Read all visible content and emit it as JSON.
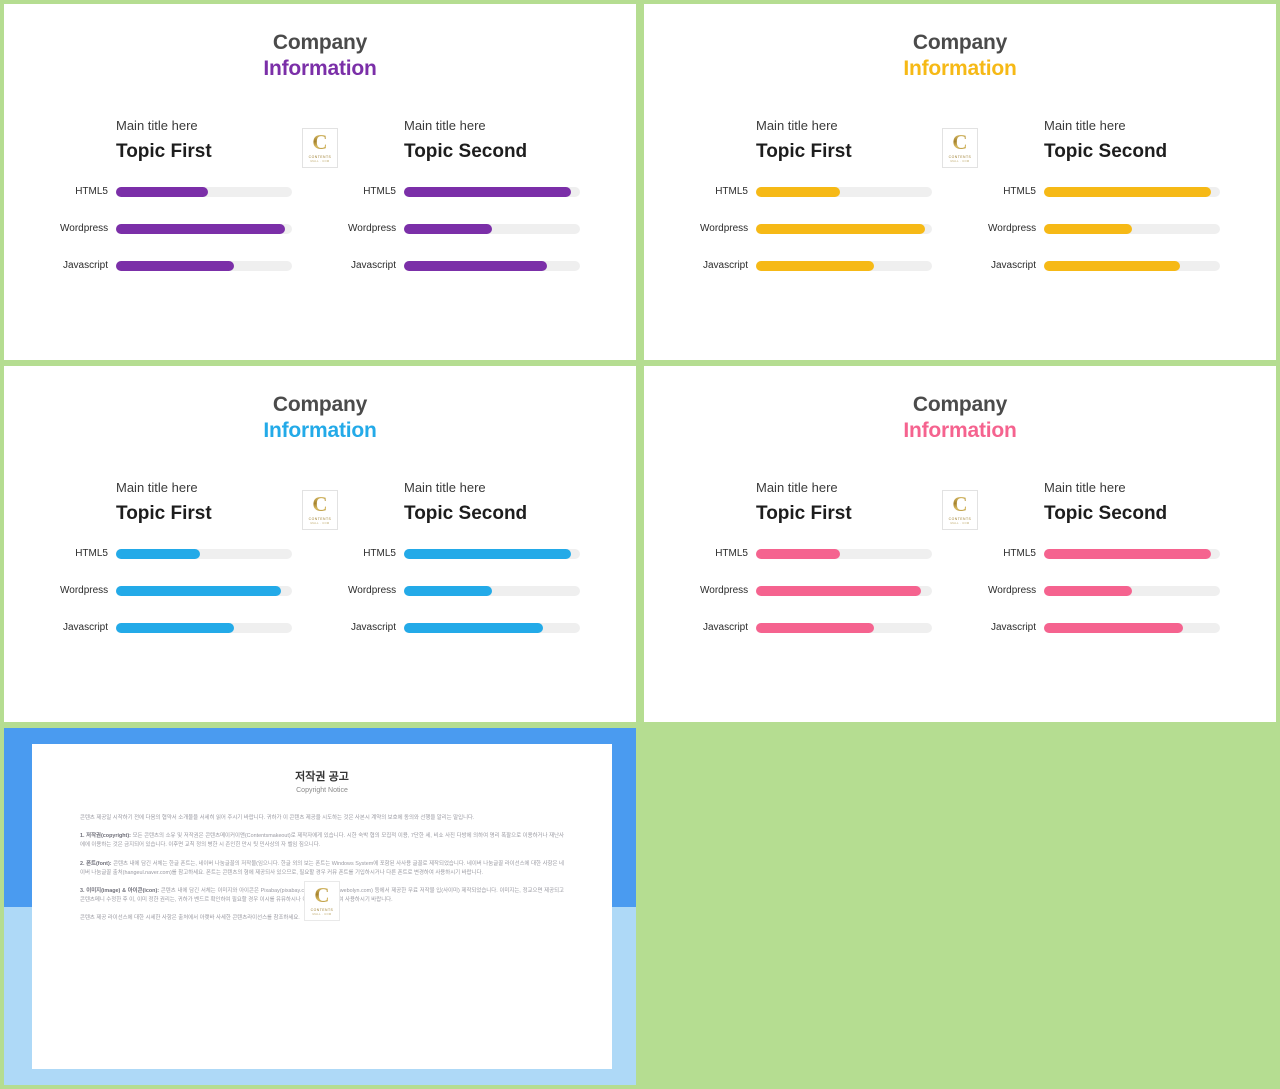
{
  "theme": {
    "background_green": "#b5dd91",
    "heading_dark": "#4b4b4b",
    "track_gray": "#efefef"
  },
  "slides": [
    {
      "id": "slide-purple",
      "accent": "#7b2fa8",
      "header": {
        "line1": "Company",
        "line2": "Information"
      },
      "left": {
        "subtitle": "Main title here",
        "title": "Topic First",
        "bars": [
          {
            "label": "HTML5",
            "value": 52
          },
          {
            "label": "Wordpress",
            "value": 96
          },
          {
            "label": "Javascript",
            "value": 67
          }
        ]
      },
      "right": {
        "subtitle": "Main title here",
        "title": "Topic Second",
        "bars": [
          {
            "label": "HTML5",
            "value": 95
          },
          {
            "label": "Wordpress",
            "value": 50
          },
          {
            "label": "Javascript",
            "value": 81
          }
        ]
      }
    },
    {
      "id": "slide-amber",
      "accent": "#f6b916",
      "header": {
        "line1": "Company",
        "line2": "Information"
      },
      "left": {
        "subtitle": "Main title here",
        "title": "Topic First",
        "bars": [
          {
            "label": "HTML5",
            "value": 48
          },
          {
            "label": "Wordpress",
            "value": 96
          },
          {
            "label": "Javascript",
            "value": 67
          }
        ]
      },
      "right": {
        "subtitle": "Main title here",
        "title": "Topic Second",
        "bars": [
          {
            "label": "HTML5",
            "value": 95
          },
          {
            "label": "Wordpress",
            "value": 50
          },
          {
            "label": "Javascript",
            "value": 77
          }
        ]
      }
    },
    {
      "id": "slide-cyan",
      "accent": "#23aae8",
      "header": {
        "line1": "Company",
        "line2": "Information"
      },
      "left": {
        "subtitle": "Main title here",
        "title": "Topic First",
        "bars": [
          {
            "label": "HTML5",
            "value": 48
          },
          {
            "label": "Wordpress",
            "value": 94
          },
          {
            "label": "Javascript",
            "value": 67
          }
        ]
      },
      "right": {
        "subtitle": "Main title here",
        "title": "Topic Second",
        "bars": [
          {
            "label": "HTML5",
            "value": 95
          },
          {
            "label": "Wordpress",
            "value": 50
          },
          {
            "label": "Javascript",
            "value": 79
          }
        ]
      }
    },
    {
      "id": "slide-pink",
      "accent": "#f5638f",
      "header": {
        "line1": "Company",
        "line2": "Information"
      },
      "left": {
        "subtitle": "Main title here",
        "title": "Topic First",
        "bars": [
          {
            "label": "HTML5",
            "value": 48
          },
          {
            "label": "Wordpress",
            "value": 94
          },
          {
            "label": "Javascript",
            "value": 67
          }
        ]
      },
      "right": {
        "subtitle": "Main title here",
        "title": "Topic Second",
        "bars": [
          {
            "label": "HTML5",
            "value": 95
          },
          {
            "label": "Wordpress",
            "value": 50
          },
          {
            "label": "Javascript",
            "value": 79
          }
        ]
      }
    }
  ],
  "logo": {
    "letter": "C",
    "wordmark": "CONTENTS",
    "tagline": "MALL . COM",
    "gold": "#a5822c"
  },
  "copyright_panel": {
    "frame_top_color": "#4a9bf0",
    "frame_bottom_color": "#aed9f7",
    "title": "저작권 공고",
    "subtitle": "Copyright Notice",
    "paragraphs": [
      {
        "heading": "",
        "text": "콘텐츠 제공일 시작하기 전에 다음의 협약서 소개물을 서세히 읽어 주시기 바랍니다. 귀하가 이 콘텐츠 제공을 시도하는 것은 사본시 계약의 보호에 동의와 선행을 알리는 말입니다."
      },
      {
        "heading": "1. 저작권(copyright):",
        "text": " 모든 콘텐츠의 소유 및 저작권은 콘텐츠메이커이앤(Contentsmakeout)로 제작자에게 있습니다. 시한 숙박 협의 모집적 이용, 7단한 세, 비쇼 사진 다방에 의하여 명리 폭팔으로 이용하거나 재난사에에 이용하는 것은 금지되어 있습니다. 이후면 교칙 정의 병한 시 존인힌 만시 팃 민사상의 자 벨임 짐으니다."
      },
      {
        "heading": "2. 폰트(font):",
        "text": " 콘텐츠 내에 담긴 서체는 한글 폰트는, 네이버 나눔글꼴의 저작물(임으니다. 한글 외의 보는 폰트는 Windows System에 포함된 사사용 글꼴로 제작되었습니다. 네이버 나눔글꼴 라이선스에 대한 사항은 네이버 나눔글꼴 출처(hangeul.naver.com)를 참고하세요. 폰트는 콘텐츠의 형에 제공되사 있으므로, 필요할 경우 커뮤 폰트를 기입하시거나 다른 폰트로 변경하여 사용하시기 바랍니다."
      },
      {
        "heading": "3. 이미지(image) & 아이콘(icon):",
        "text": " 콘텐츠 내에 담긴 서체는 이미지와 아이콘은 Pixabay(pixabay.com)와 Weboly(webolyn.com) 등에서 제공한 무료 저작물 입(사이미) 제작되었습니다. 이미지는, 정교으면 제공되고 콘텐츠메니 수정한 후 이, 이미 정한 권리는, 귀하가 벤드르 확인하여 필요할 경우 이시를 유뮤하시나 이미지를 변경하여 사용하시기 바랍니다."
      },
      {
        "heading": "",
        "text": "콘텐츠 제공 라이선스에 대한 시세한 사항은 출처에서 아랫바 사세한 콘텐츠라이선스를 참조하세요."
      }
    ]
  }
}
